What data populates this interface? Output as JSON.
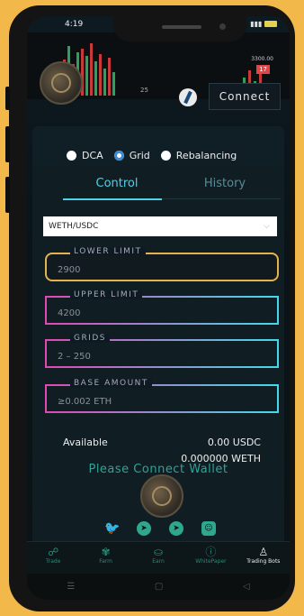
{
  "status": {
    "time": "4:19"
  },
  "chart": {
    "mid_label": "25",
    "price_top": "3300.00",
    "price_tag": "17"
  },
  "header": {
    "connect_label": "Connect"
  },
  "strategies": [
    {
      "label": "DCA",
      "selected": false
    },
    {
      "label": "Grid",
      "selected": true
    },
    {
      "label": "Rebalancing",
      "selected": false
    }
  ],
  "tabs": {
    "control": "Control",
    "history": "History"
  },
  "pair_select": {
    "value": "WETH/USDC"
  },
  "fields": {
    "lower": {
      "label": "LOWER LIMIT",
      "placeholder": "2900"
    },
    "upper": {
      "label": "UPPER LIMIT",
      "placeholder": "4200"
    },
    "grids": {
      "label": "GRIDS",
      "placeholder": "2 – 250"
    },
    "base": {
      "label": "BASE AMOUNT",
      "placeholder": "≥0.002 ETH"
    }
  },
  "available": {
    "label": "Available",
    "usdc": "0.00 USDC",
    "weth": "0.000000 WETH"
  },
  "connect_prompt": "Please Connect Wallet",
  "nav": [
    {
      "label": "Trade",
      "icon": "☍"
    },
    {
      "label": "Farm",
      "icon": "✾"
    },
    {
      "label": "Earn",
      "icon": "⛀"
    },
    {
      "label": "WhitePaper",
      "icon": "ⓘ"
    },
    {
      "label": "Trading Bots",
      "icon": "♙"
    }
  ],
  "colors": {
    "accent": "#4fd2e6",
    "gold_border": "#e5b24e",
    "social": "#2fa78d"
  }
}
